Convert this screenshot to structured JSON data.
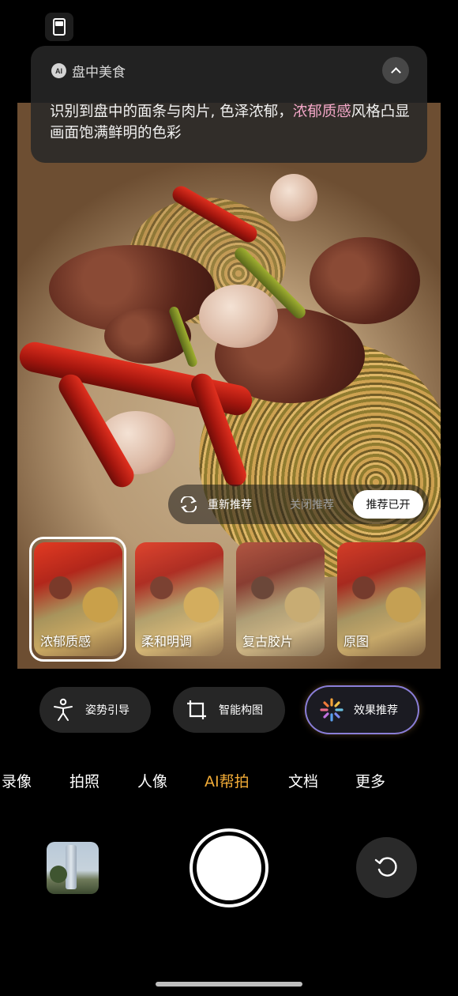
{
  "ai_card": {
    "badge": "AI",
    "title": "盘中美食",
    "description_before": "识别到盘中的面条与肉片, 色泽浓郁，",
    "description_highlight": "浓郁质感",
    "description_after": "风格凸显画面饱满鲜明的色彩",
    "highlight_color": "#f3a7c8"
  },
  "recommend": {
    "refresh_label": "重新推荐",
    "close_label": "关闭推荐",
    "on_label": "推荐已开"
  },
  "filters": [
    {
      "label": "浓郁质感",
      "selected": true
    },
    {
      "label": "柔和明调",
      "selected": false
    },
    {
      "label": "复古胶片",
      "selected": false
    },
    {
      "label": "原图",
      "selected": false
    }
  ],
  "assist_buttons": {
    "pose_label": "姿势引导",
    "composition_label": "智能构图",
    "effect_label": "效果推荐"
  },
  "modes": {
    "items": [
      "录像",
      "拍照",
      "人像",
      "AI帮拍",
      "文档",
      "更多"
    ],
    "active": "AI帮拍",
    "active_color": "#f1ab37"
  },
  "icons": {
    "mode": "camera-mode-icon",
    "collapse": "chevron-up-icon",
    "refresh": "refresh-icon",
    "pose": "person-pose-icon",
    "composition": "crop-icon",
    "effect": "sparkle-icon",
    "flip": "rotate-camera-icon"
  }
}
